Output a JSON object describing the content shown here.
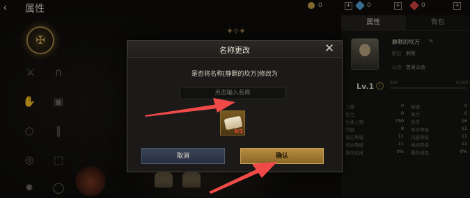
{
  "header": {
    "title": "属性"
  },
  "currencies": [
    {
      "icon": "gold-coin-icon",
      "value": "0",
      "color": "#c9a24a"
    },
    {
      "icon": "blue-gem-icon",
      "value": "0",
      "color": "#5aa7e0"
    },
    {
      "icon": "red-gem-icon",
      "value": "0",
      "color": "#d94848"
    }
  ],
  "panel": {
    "tabs": [
      {
        "label": "属性"
      },
      {
        "label": "背包"
      }
    ],
    "player_name": "静默的坎万",
    "rows": [
      {
        "label": "职业",
        "value": "刺客"
      },
      {
        "label": "公会",
        "value": "首发公会"
      }
    ],
    "level": "Lv.1",
    "exp_label": "EXP",
    "exp_value": "0/100",
    "exp_fraction": 0.0,
    "stats": [
      {
        "left_name": "力量",
        "left_value": "0",
        "right_name": "敏捷",
        "right_value": "0"
      },
      {
        "left_name": "智力",
        "left_value": "0",
        "right_name": "体力",
        "right_value": "0"
      },
      {
        "left_name": "生命上限",
        "left_value": "750",
        "right_name": "攻击",
        "right_value": "16"
      },
      {
        "left_name": "防御",
        "left_value": "8",
        "right_name": "命中等级",
        "right_value": "11"
      },
      {
        "left_name": "暴击等级",
        "left_value": "11",
        "right_name": "闪避等级",
        "right_value": "11"
      },
      {
        "left_name": "抵抗等级",
        "left_value": "11",
        "right_name": "格挡等级",
        "right_value": "11"
      },
      {
        "left_name": "暴伤加成",
        "left_value": "0%",
        "right_name": "暴伤减免",
        "right_value": "0%"
      }
    ]
  },
  "modal": {
    "title": "名称更改",
    "prompt": "是否将名称[静默的坎万]修改为",
    "input_placeholder": "点击输入名称",
    "item_icon": "rename-scroll-icon",
    "item_count": "0/1",
    "cancel_label": "取消",
    "confirm_label": "确认"
  },
  "colors": {
    "accent_gold": "#b78c3f",
    "cancel_blue": "#3a4456",
    "arrow_red": "#ef4a48"
  }
}
